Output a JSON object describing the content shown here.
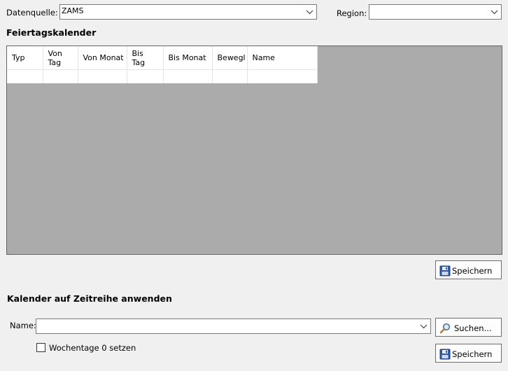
{
  "datasource": {
    "label": "Datenquelle:",
    "value": "ZAMS"
  },
  "region": {
    "label": "Region:",
    "value": ""
  },
  "holiday_calendar": {
    "title": "Feiertagskalender",
    "columns": [
      "Typ",
      "Von Tag",
      "Von Monat",
      "Bis Tag",
      "Bis Monat",
      "Bewegl",
      "Name"
    ],
    "rows": [
      [
        "",
        "",
        "",
        "",
        "",
        "",
        ""
      ]
    ],
    "save_label": "Speichern"
  },
  "apply_calendar": {
    "title": "Kalender auf Zeitreihe anwenden",
    "name_label": "Name:",
    "name_value": "",
    "search_label": "Suchen...",
    "checkbox_label": "Wochentage 0 setzen",
    "checkbox_checked": false,
    "save_label": "Speichern"
  },
  "icons": {
    "dropdown": "chevron-down-icon",
    "save": "floppy-disk-icon",
    "search": "magnifier-icon"
  }
}
